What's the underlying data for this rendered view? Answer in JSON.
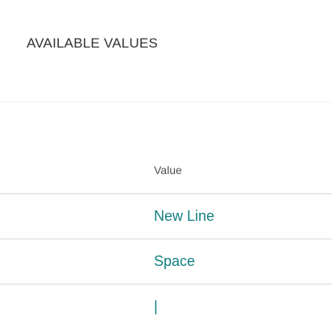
{
  "panel": {
    "title": "AVAILABLE VALUES"
  },
  "table": {
    "column_header": "Value",
    "rows": [
      {
        "value": "New Line"
      },
      {
        "value": "Space"
      },
      {
        "value": "|"
      }
    ]
  },
  "colors": {
    "title_text": "#333333",
    "header_text": "#505050",
    "link_text": "#137e80",
    "divider": "#d8d8d8"
  }
}
